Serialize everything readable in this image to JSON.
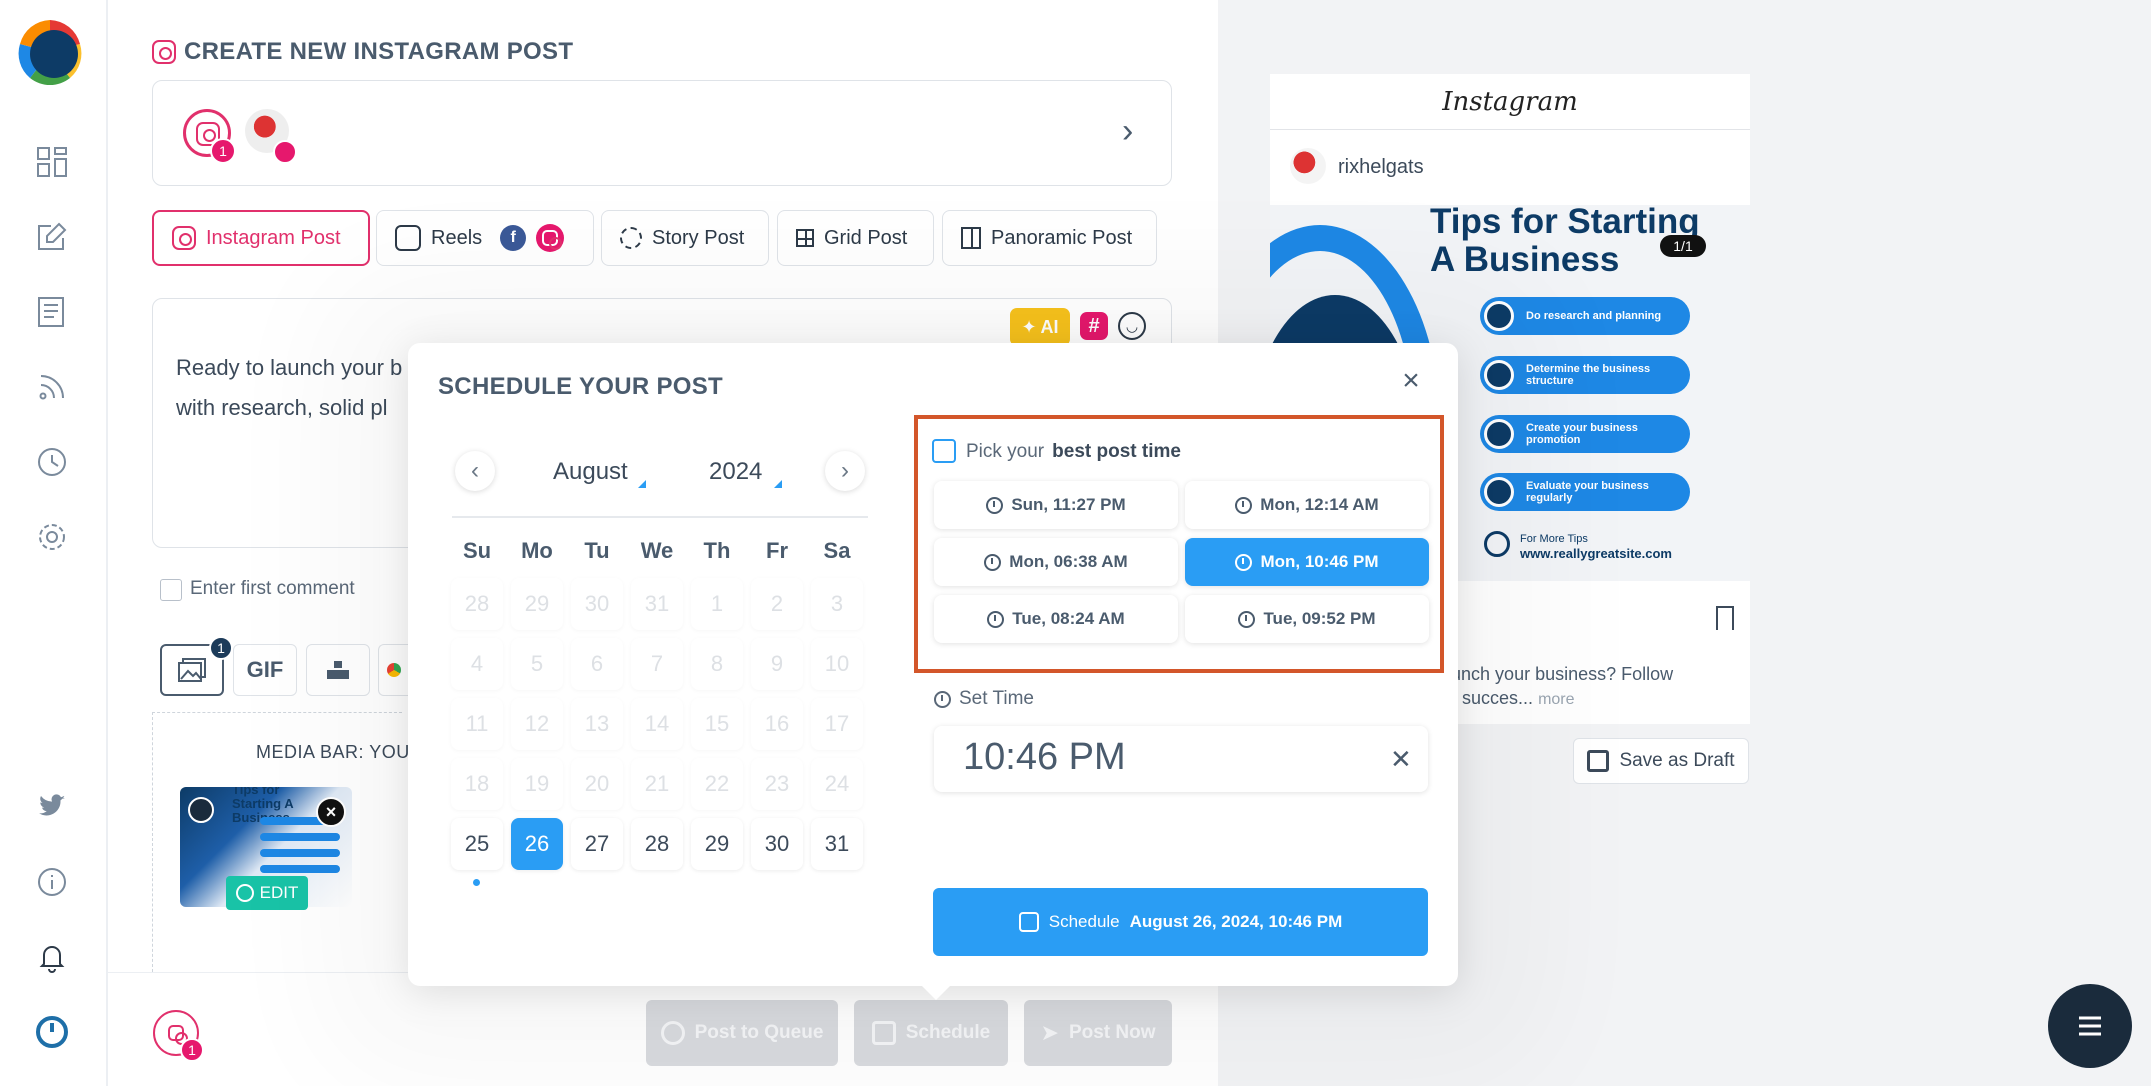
{
  "app": {
    "page_title": "CREATE NEW INSTAGRAM POST",
    "account_badge_count": "1",
    "footer_badge_count": "1"
  },
  "tabs": [
    {
      "label": "Instagram Post"
    },
    {
      "label": "Reels"
    },
    {
      "label": "Story Post"
    },
    {
      "label": "Grid Post"
    },
    {
      "label": "Panoramic Post"
    }
  ],
  "editor": {
    "text_line1": "Ready to launch your b",
    "text_line2": "with research, solid pl",
    "ai_label": "AI",
    "hash_label": "#"
  },
  "first_comment": {
    "label": "Enter first comment"
  },
  "media_toolbar": {
    "image_badge": "1",
    "gif_label": "GIF"
  },
  "media_bar": {
    "label": "MEDIA BAR: YOU",
    "edit_label": "EDIT",
    "thumb_title": "Tips for Starting A Business"
  },
  "footer": {
    "queue_label": "Post to Queue",
    "schedule_label": "Schedule",
    "post_now_label": "Post Now"
  },
  "preview": {
    "platform": "Instagram",
    "username": "rixhelgats",
    "image_title_line1": "Tips for Starting",
    "image_title_line2": "A Business",
    "page_indicator": "1/1",
    "steps": [
      "Do research and planning",
      "Determine the business structure",
      "Create your business promotion",
      "Evaluate your business regularly"
    ],
    "more_tips": "For More Tips",
    "site": "www.reallygreatsite.com",
    "caption_line1": "o launch your business? Follow",
    "caption_line2": "s for succes...",
    "more_label": "more",
    "save_draft_label": "Save as Draft"
  },
  "schedule_modal": {
    "title": "SCHEDULE YOUR POST",
    "close": "×",
    "month": "August",
    "year": "2024",
    "weekdays": [
      "Su",
      "Mo",
      "Tu",
      "We",
      "Th",
      "Fr",
      "Sa"
    ],
    "weeks": [
      [
        "28",
        "29",
        "30",
        "31",
        "1",
        "2",
        "3"
      ],
      [
        "4",
        "5",
        "6",
        "7",
        "8",
        "9",
        "10"
      ],
      [
        "11",
        "12",
        "13",
        "14",
        "15",
        "16",
        "17"
      ],
      [
        "18",
        "19",
        "20",
        "21",
        "22",
        "23",
        "24"
      ],
      [
        "25",
        "26",
        "27",
        "28",
        "29",
        "30",
        "31"
      ]
    ],
    "selected_day": "26",
    "today_day": "25",
    "best_time_prefix": "Pick your",
    "best_time_bold": "best post time",
    "best_times": [
      "Sun, 11:27 PM",
      "Mon, 12:14 AM",
      "Mon, 06:38 AM",
      "Mon, 10:46 PM",
      "Tue, 08:24 AM",
      "Tue, 09:52 PM"
    ],
    "selected_best_time_index": 3,
    "set_time_label": "Set Time",
    "set_time_value": "10:46 PM",
    "schedule_prefix": "Schedule",
    "schedule_datetime": "August 26, 2024, 10:46 PM"
  },
  "colors": {
    "accent": "#2a9df4",
    "instagram": "#e1306c",
    "highlight_border": "#d3562a",
    "ai": "#f7c21c"
  }
}
